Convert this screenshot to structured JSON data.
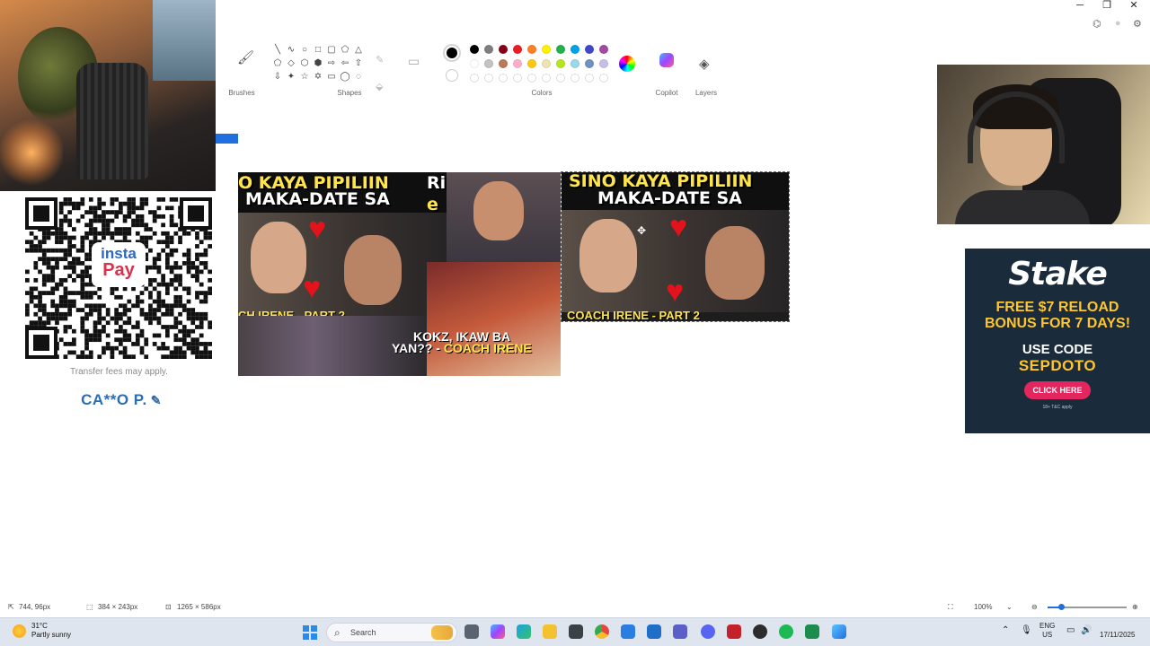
{
  "window": {
    "controls": {
      "minimize": "─",
      "restore": "❐",
      "close": "✕"
    }
  },
  "ribbon": {
    "groups": [
      "Brushes",
      "Shapes",
      "Colors",
      "Copilot",
      "Layers"
    ],
    "shape_glyphs": [
      "╲",
      "∿",
      "○",
      "□",
      "▢",
      "⬠",
      "△",
      "⬠",
      "◇",
      "⬡",
      "⬢",
      "⇨",
      "⇦",
      "⇧",
      "⇩",
      "✦",
      "☆",
      "✡",
      "▭",
      "◯",
      "◌"
    ],
    "color_row_1": [
      "#000000",
      "#7f7f7f",
      "#880015",
      "#ed1c24",
      "#ff7f27",
      "#fff200",
      "#22b14c",
      "#00a2e8",
      "#3f48cc",
      "#a349a4"
    ],
    "color_row_2": [
      "#ffffff",
      "#c3c3c3",
      "#b97a57",
      "#ffaec9",
      "#ffc90e",
      "#efe4b0",
      "#b5e61d",
      "#99d9ea",
      "#7092be",
      "#c8bfe7"
    ],
    "color_row_3_empty": 10,
    "primary_color": "#000000",
    "secondary_color": "#ffffff"
  },
  "left_overlay": {
    "qr_brand_line1": "insta",
    "qr_brand_line2": "Pay",
    "transfer_note": "Transfer fees may apply.",
    "account_name": "CA**O P."
  },
  "canvas": {
    "thumb_left": {
      "headline_line1": "O KAYA PIPILIIN",
      "headline_line2": "MAKA-DATE SA",
      "headline_extra": "Rin",
      "headline_extra2": "e",
      "caption_line1": "KOKZ, IKAW BA",
      "caption_line2": "YAN?? -",
      "caption_coach": "COACH IRENE",
      "footer_fragment": "CH IRENE - PART 2"
    },
    "thumb_right": {
      "headline_line1": "SINO KAYA PIPILIIN",
      "headline_line2": "MAKA-DATE SA",
      "footer_fragment": "COACH IRENE - PART 2"
    }
  },
  "right_overlay": {
    "ad": {
      "brand": "Stake",
      "promo_line1": "FREE $7 RELOAD",
      "promo_line2": "BONUS FOR 7 DAYS!",
      "use_code": "USE CODE",
      "code": "SEPDOTO",
      "cta": "CLICK HERE",
      "fine_print": "18+ T&C apply"
    }
  },
  "statusbar": {
    "cursor_position": "744, 96px",
    "selection_size": "384 × 243px",
    "canvas_size": "1265 × 586px",
    "zoom": "100%"
  },
  "taskbar": {
    "weather_temp": "31°C",
    "weather_desc": "Partly sunny",
    "search_placeholder": "Search",
    "language_line1": "ENG",
    "language_line2": "US",
    "date": "17/11/2025"
  }
}
